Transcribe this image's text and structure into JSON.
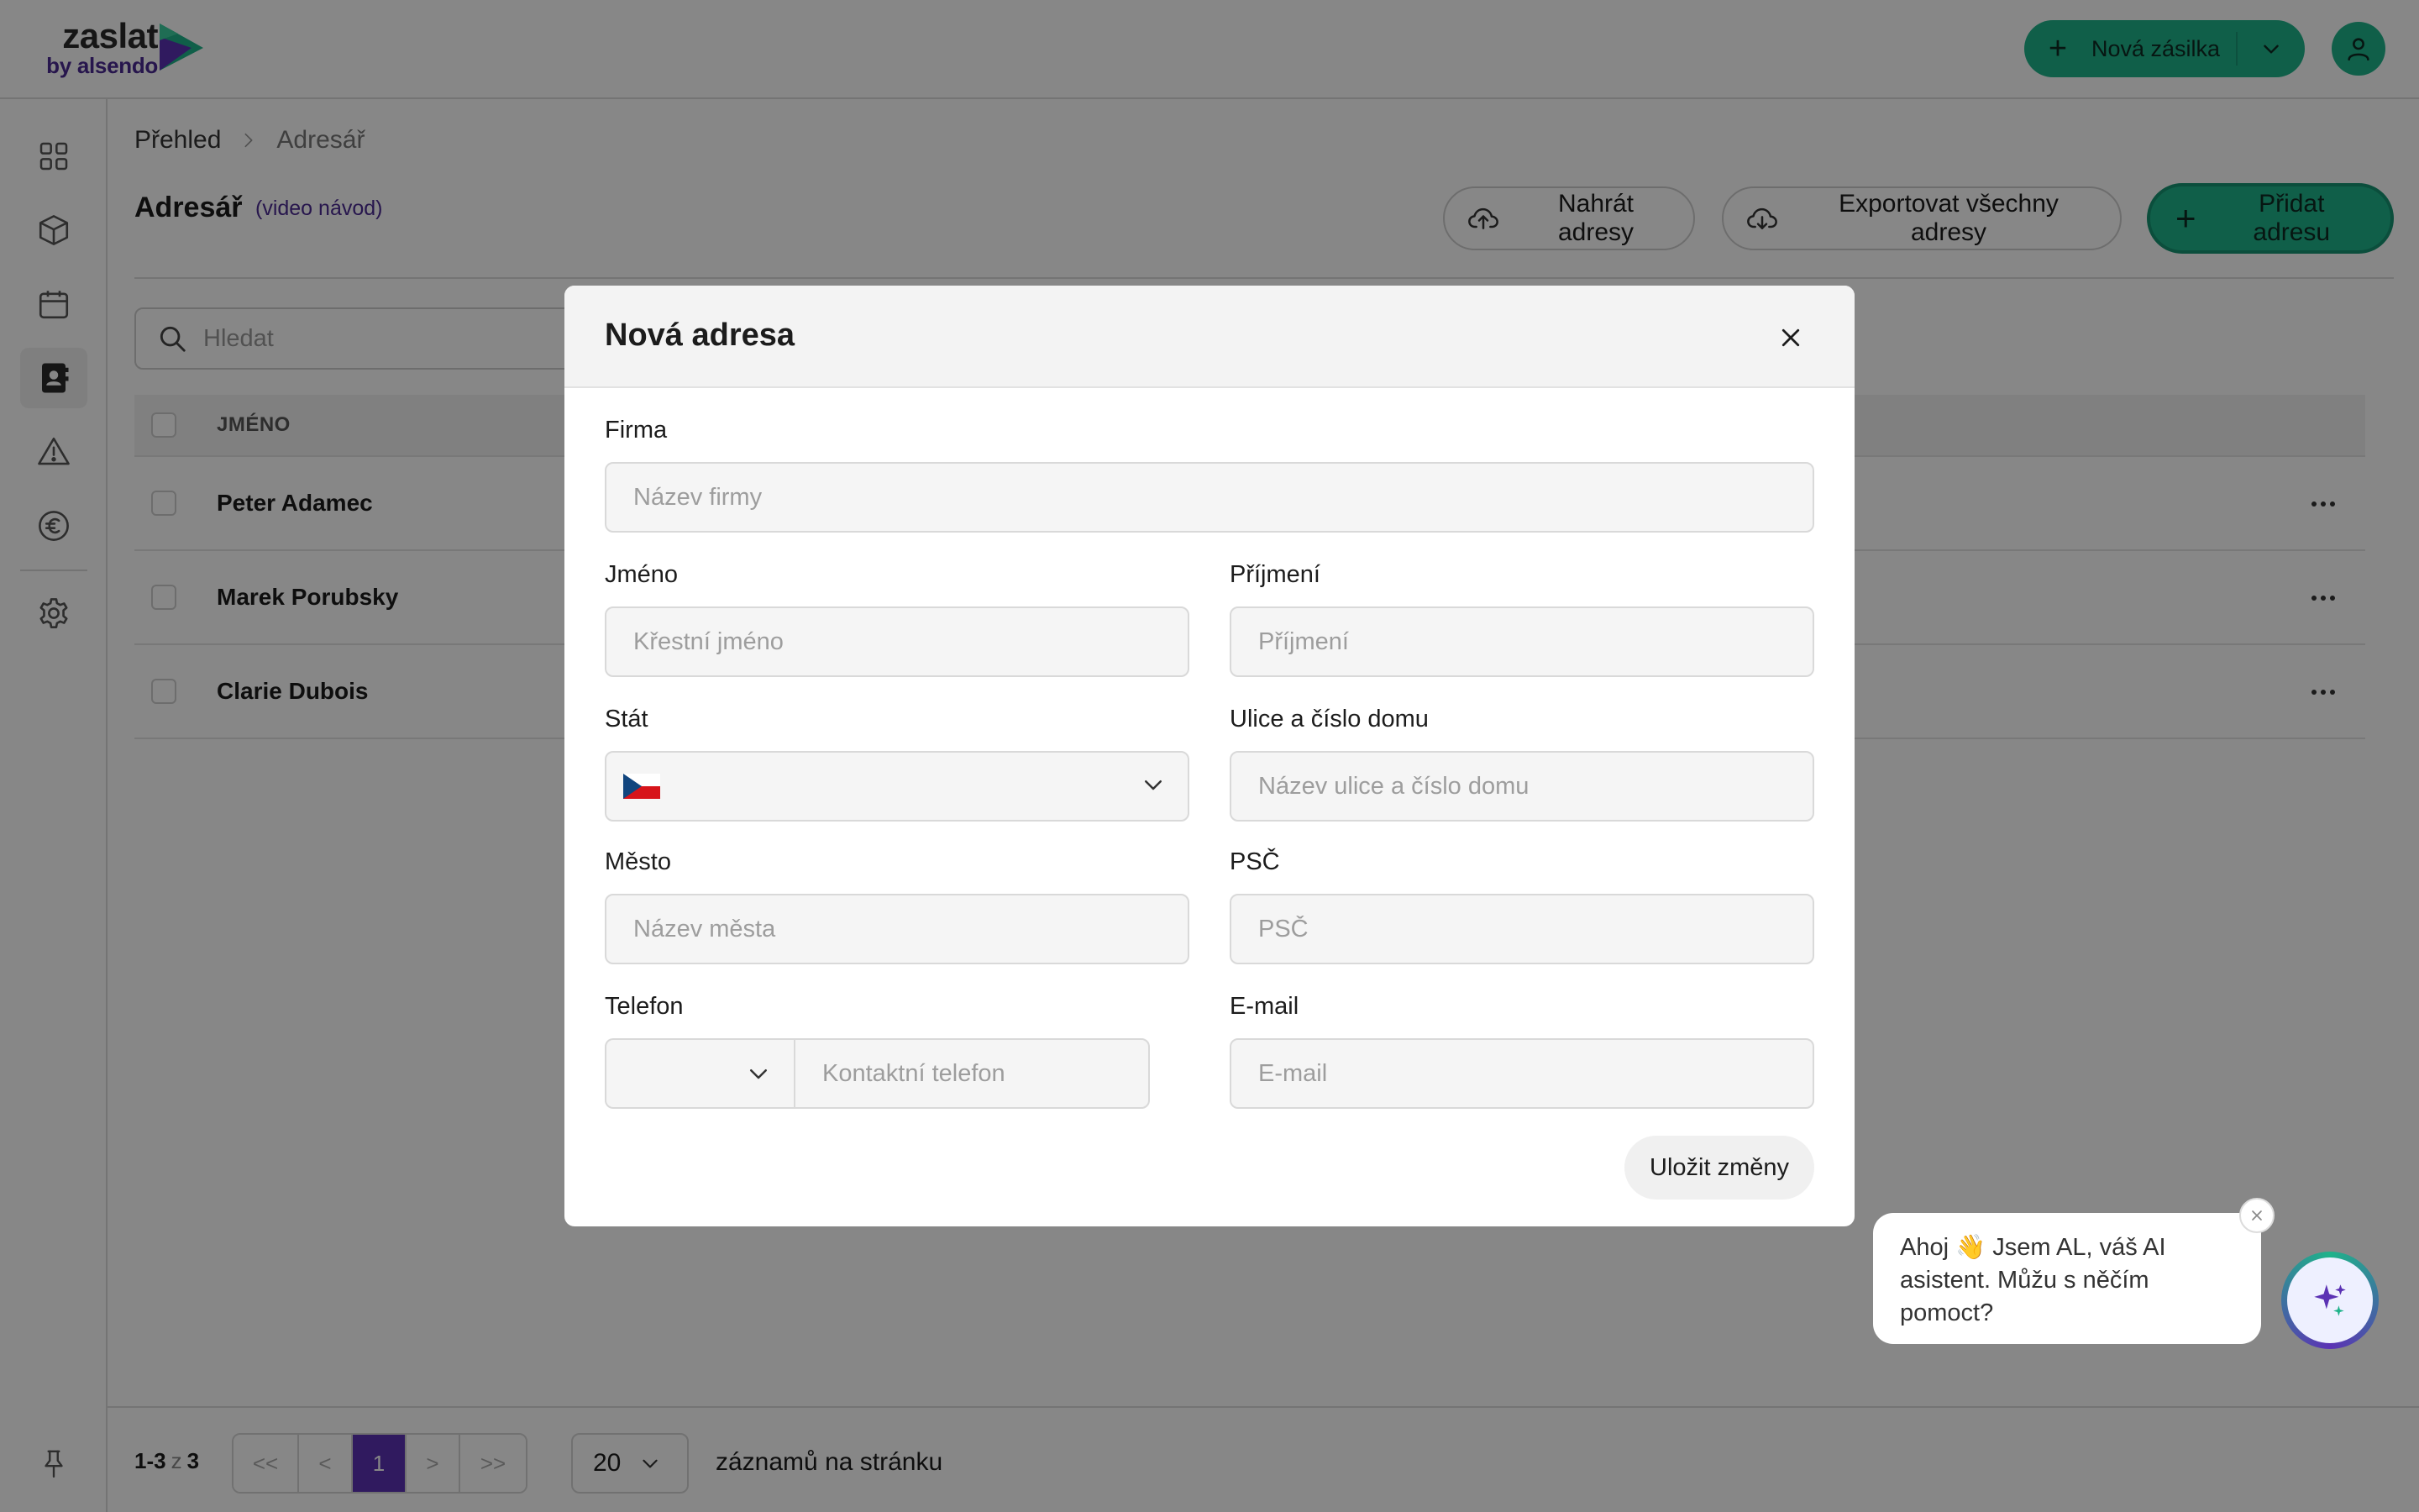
{
  "brand": {
    "name": "zaslat",
    "tagline": "by alsendo"
  },
  "topbar": {
    "new_shipment_label": "Nová zásilka"
  },
  "breadcrumb": {
    "home": "Přehled",
    "current": "Adresář"
  },
  "page": {
    "title": "Adresář",
    "video_link": "(video návod)",
    "upload_label": "Nahrát adresy",
    "export_label": "Exportovat všechny adresy",
    "add_label": "Přidat adresu"
  },
  "search": {
    "placeholder": "Hledat"
  },
  "table": {
    "header_name": "JMÉNO",
    "rows": [
      {
        "name": "Peter Adamec"
      },
      {
        "name": "Marek Porubsky"
      },
      {
        "name": "Clarie Dubois"
      }
    ]
  },
  "pagination": {
    "range": "1-3",
    "of": "z",
    "total": "3",
    "first": "<<",
    "prev": "<",
    "current_page": "1",
    "next": ">",
    "last": ">>",
    "per_page_value": "20",
    "per_page_label": "záznamů na stránku"
  },
  "modal": {
    "title": "Nová adresa",
    "company_label": "Firma",
    "company_placeholder": "Název firmy",
    "first_name_label": "Jméno",
    "first_name_placeholder": "Křestní jméno",
    "last_name_label": "Příjmení",
    "last_name_placeholder": "Příjmení",
    "country_label": "Stát",
    "country_flag": "czech-flag-icon",
    "street_label": "Ulice a číslo domu",
    "street_placeholder": "Název ulice a číslo domu",
    "city_label": "Město",
    "city_placeholder": "Název města",
    "zip_label": "PSČ",
    "zip_placeholder": "PSČ",
    "phone_label": "Telefon",
    "phone_placeholder": "Kontaktní telefon",
    "email_label": "E-mail",
    "email_placeholder": "E-mail",
    "save_label": "Uložit změny"
  },
  "chat": {
    "message": "Ahoj 👋 Jsem AL, váš AI asistent. Můžu s něčím pomoct?"
  },
  "colors": {
    "accent": "#1fb38a",
    "brand_purple": "#5b32b4",
    "overlay": "#000000"
  }
}
